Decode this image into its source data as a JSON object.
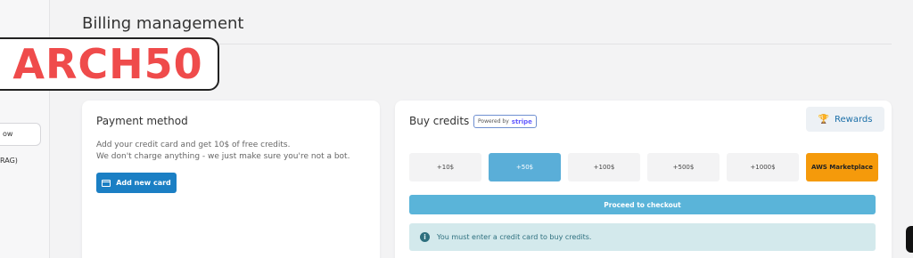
{
  "sidebar": {
    "item1_label": "ow",
    "item2_label": "RAG)"
  },
  "page": {
    "title": "Billing management"
  },
  "watermark": {
    "text": "ARCH50"
  },
  "payment": {
    "title": "Payment method",
    "line1": "Add your credit card and get 10$ of free credits.",
    "line2": "We don't charge anything - we just make sure you're not a bot.",
    "add_card_label": "Add new card"
  },
  "buy": {
    "title": "Buy credits",
    "powered_by": "Powered by",
    "stripe": "stripe",
    "rewards_label": "Rewards",
    "amounts": [
      {
        "label": "+10$"
      },
      {
        "label": "+50$"
      },
      {
        "label": "+100$"
      },
      {
        "label": "+500$"
      },
      {
        "label": "+1000$"
      },
      {
        "label": "AWS Marketplace"
      }
    ],
    "selected_amount": "+50$",
    "checkout_label": "Proceed to checkout",
    "info_message": "You must enter a credit card to buy credits."
  },
  "colors": {
    "primary_button": "#1b7fc4",
    "selected_amount": "#5aaed8",
    "aws": "#f59a0b",
    "checkout": "#5ab4d9",
    "info_bg": "#d3e9ec",
    "watermark": "#ef4b4b"
  },
  "icons": {
    "add_card": "credit-card-icon",
    "rewards": "trophy-icon",
    "info": "info-icon"
  }
}
